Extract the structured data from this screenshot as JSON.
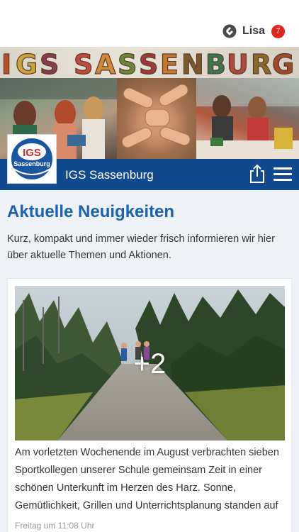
{
  "status": {
    "user_name": "Lisa",
    "notification_count": "7"
  },
  "banner": {
    "lettering": "IGS SASSENBURG"
  },
  "logo": {
    "line1": "IGS",
    "line2": "Sassenburg"
  },
  "site_bar": {
    "title": "IGS Sassenburg"
  },
  "main": {
    "heading": "Aktuelle Neuigkeiten",
    "intro": "Kurz, kompakt und immer wieder frisch informieren wir hier über aktuelle Themen und Aktionen."
  },
  "news": [
    {
      "more_photos": "+2",
      "text": "Am vorletzten Wochenende im August verbrachten sieben Sportkollegen unserer Schule gemeinsam Zeit in einer schönen Unterkunft im Herzen des Harz. Sonne, Gemütlichkeit, Grillen und Unterrichtsplanung standen auf",
      "date": "Freitag um 11:08 Uhr"
    }
  ],
  "colors": {
    "brand_blue": "#114a8f",
    "heading_blue": "#1a62ae",
    "badge_red": "#e2231a",
    "page_background": "#eef1f5"
  },
  "icons": {
    "app": "app-logo-icon",
    "share": "share-icon",
    "menu": "hamburger-menu-icon"
  }
}
